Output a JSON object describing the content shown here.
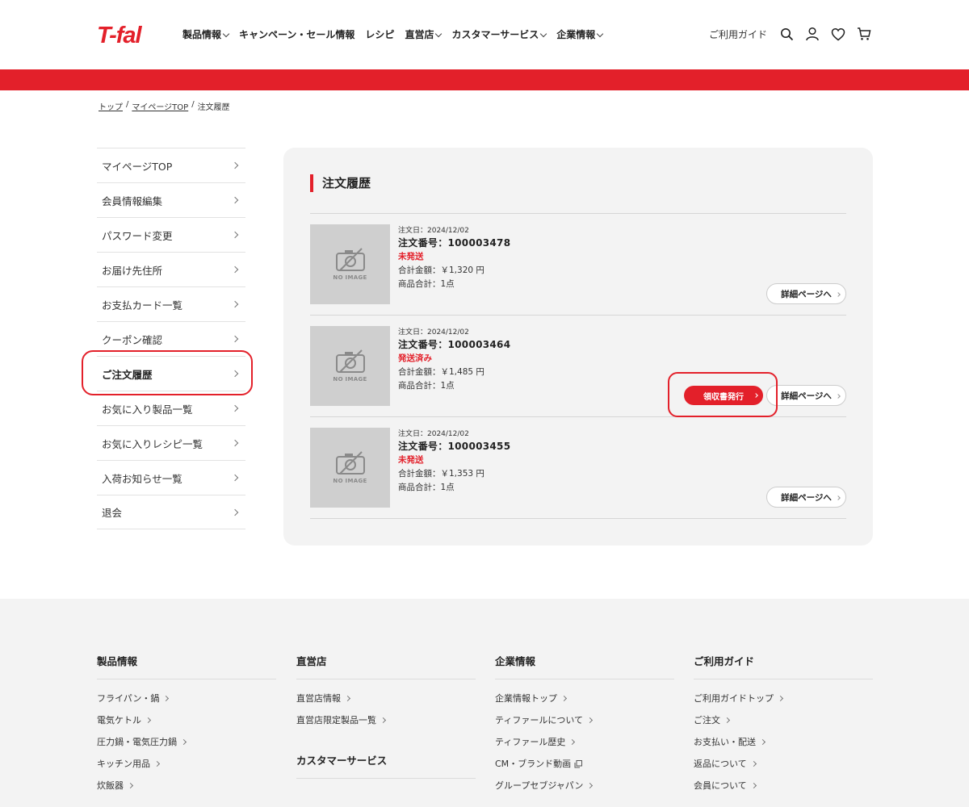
{
  "brand": {
    "logo_text": "T-fal",
    "accent_color": "#e3202a"
  },
  "header": {
    "nav": [
      {
        "label": "製品情報",
        "has_dropdown": true
      },
      {
        "label": "キャンペーン・セール情報",
        "has_dropdown": false
      },
      {
        "label": "レシピ",
        "has_dropdown": false
      },
      {
        "label": "直営店",
        "has_dropdown": true
      },
      {
        "label": "カスタマーサービス",
        "has_dropdown": true
      },
      {
        "label": "企業情報",
        "has_dropdown": true
      }
    ],
    "guide_label": "ご利用ガイド",
    "icons": [
      "search-icon",
      "account-icon",
      "heart-icon",
      "cart-icon"
    ]
  },
  "breadcrumb": {
    "home": "トップ",
    "mypage": "マイページTOP",
    "current": "注文履歴"
  },
  "sidebar": {
    "items": [
      {
        "label": "マイページTOP"
      },
      {
        "label": "会員情報編集"
      },
      {
        "label": "パスワード変更"
      },
      {
        "label": "お届け先住所"
      },
      {
        "label": "お支払カード一覧"
      },
      {
        "label": "クーポン確認"
      },
      {
        "label": "ご注文履歴",
        "active": true
      },
      {
        "label": "お気に入り製品一覧"
      },
      {
        "label": "お気に入りレシピ一覧"
      },
      {
        "label": "入荷お知らせ一覧"
      },
      {
        "label": "退会"
      }
    ]
  },
  "main": {
    "title": "注文履歴",
    "no_image_label": "NO IMAGE",
    "detail_label": "詳細ページへ",
    "receipt_label": "領収書発行",
    "orders": [
      {
        "date": "注文日：2024/12/02",
        "number": "注文番号：100003478",
        "status": "未発送",
        "total": "合計金額：￥1,320 円",
        "count": "商品合計：1点"
      },
      {
        "date": "注文日：2024/12/02",
        "number": "注文番号：100003464",
        "status": "発送済み",
        "total": "合計金額：￥1,485 円",
        "count": "商品合計：1点"
      },
      {
        "date": "注文日：2024/12/02",
        "number": "注文番号：100003455",
        "status": "未発送",
        "total": "合計金額：￥1,353 円",
        "count": "商品合計：1点"
      }
    ]
  },
  "footer": {
    "products": {
      "title": "製品情報",
      "links": [
        "フライパン・鍋",
        "電気ケトル",
        "圧力鍋・電気圧力鍋",
        "キッチン用品",
        "炊飯器"
      ]
    },
    "stores": {
      "title": "直営店",
      "links": [
        "直営店情報",
        "直営店限定製品一覧"
      ]
    },
    "customer": {
      "title": "カスタマーサービス"
    },
    "company": {
      "title": "企業情報",
      "links": [
        "企業情報トップ",
        "ティファールについて",
        "ティファール歴史",
        "CM・ブランド動画",
        "グループセブジャパン"
      ]
    },
    "guide": {
      "title": "ご利用ガイド",
      "links": [
        "ご利用ガイドトップ",
        "ご注文",
        "お支払い・配送",
        "返品について",
        "会員について"
      ]
    }
  }
}
